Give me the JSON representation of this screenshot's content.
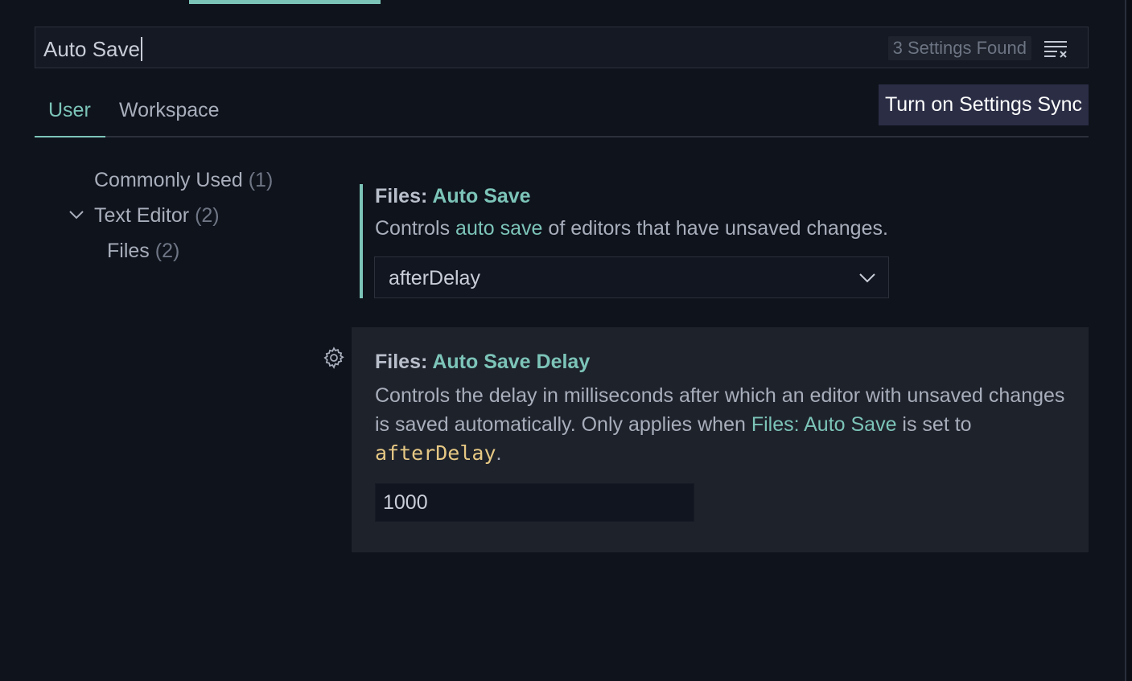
{
  "search": {
    "value": "Auto Save",
    "results_count": "3 Settings Found",
    "clear_icon": "clear-filter-icon"
  },
  "tabs": [
    {
      "label": "User",
      "active": true
    },
    {
      "label": "Workspace",
      "active": false
    }
  ],
  "sync_button": {
    "label": "Turn on Settings Sync"
  },
  "toc": {
    "items": [
      {
        "label": "Commonly Used",
        "count": "(1)"
      },
      {
        "label": "Text Editor",
        "count": "(2)",
        "expanded": true
      },
      {
        "label": "Files",
        "count": "(2)"
      }
    ]
  },
  "settings": [
    {
      "category": "Files: ",
      "name": "Auto Save",
      "desc_before": "Controls ",
      "desc_link": "auto save",
      "desc_after": " of editors that have unsaved changes.",
      "value": "afterDelay"
    },
    {
      "category": "Files: ",
      "name": "Auto Save Delay",
      "desc_part1": "Controls the delay in milliseconds after which an editor with unsaved changes is saved automatically. Only applies when ",
      "desc_link": "Files: Auto Save",
      "desc_part2": " is set to ",
      "desc_code": "afterDelay",
      "desc_part3": ".",
      "value": "1000"
    }
  ],
  "colors": {
    "accent": "#7cc4b8",
    "background": "#0f131c",
    "code": "#e6c884",
    "sync_button_bg": "#2a2d44"
  }
}
